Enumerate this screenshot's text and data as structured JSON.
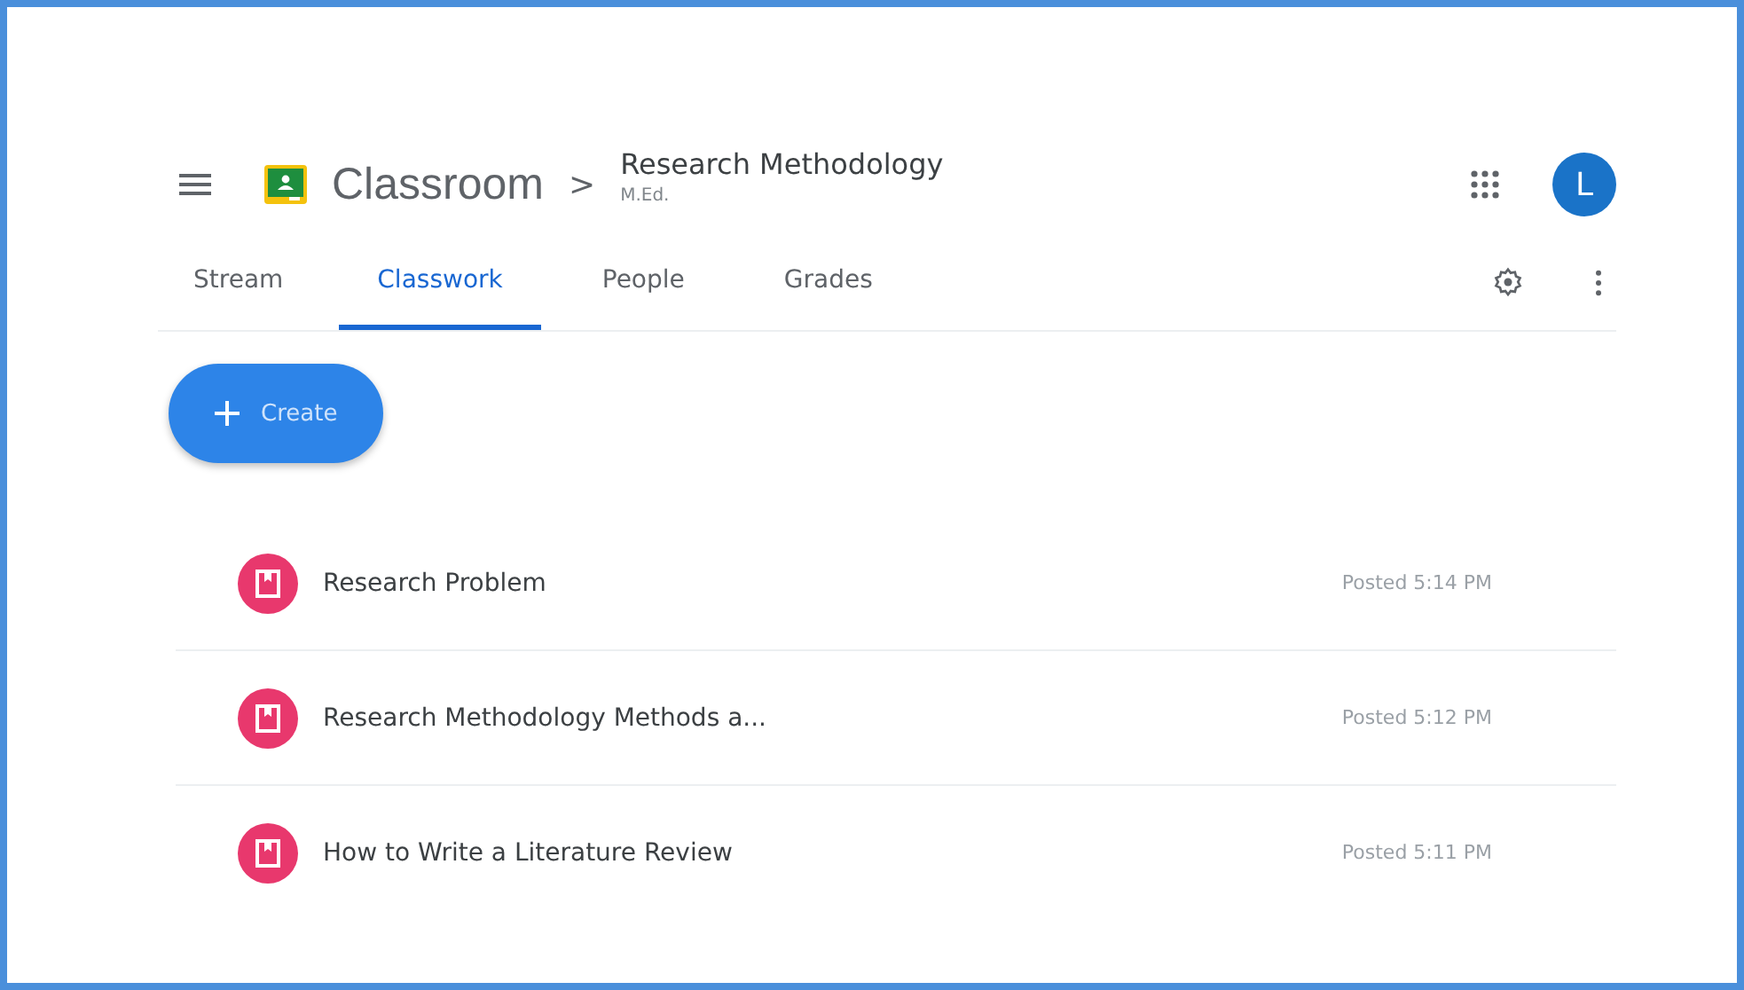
{
  "header": {
    "app_name": "Classroom",
    "separator": ">",
    "course": {
      "title": "Research Methodology",
      "section": "M.Ed."
    },
    "avatar_letter": "L"
  },
  "tabs": [
    {
      "label": "Stream",
      "selected": false
    },
    {
      "label": "Classwork",
      "selected": true
    },
    {
      "label": "People",
      "selected": false
    },
    {
      "label": "Grades",
      "selected": false
    }
  ],
  "create_button": {
    "label": "Create"
  },
  "items": [
    {
      "title": "Research Problem",
      "posted": "Posted 5:14 PM"
    },
    {
      "title": "Research Methodology Methods a...",
      "posted": "Posted 5:12 PM"
    },
    {
      "title": "How to Write a Literature Review",
      "posted": "Posted 5:11 PM"
    }
  ]
}
